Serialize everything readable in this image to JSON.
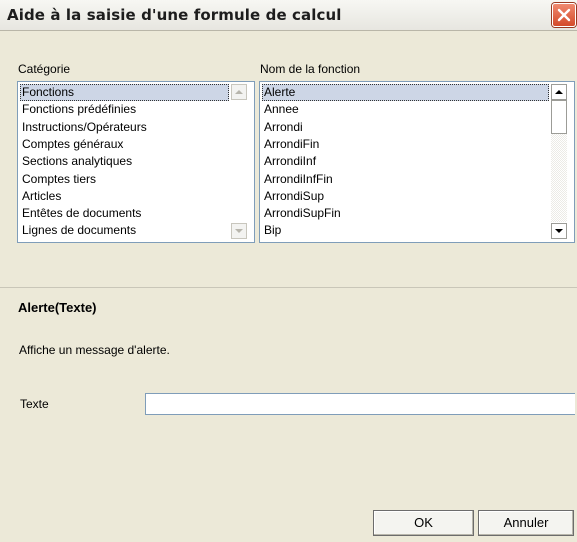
{
  "window": {
    "title": "Aide à la saisie d'une formule de calcul",
    "close_icon": "close-icon"
  },
  "category": {
    "label": "Catégorie",
    "items": [
      "Fonctions",
      "Fonctions prédéfinies",
      "Instructions/Opérateurs",
      "Comptes généraux",
      "Sections analytiques",
      "Comptes tiers",
      "Articles",
      "Entêtes de documents",
      "Lignes de documents"
    ],
    "selected": "Fonctions"
  },
  "function_list": {
    "label": "Nom de la fonction",
    "items": [
      "Alerte",
      "Annee",
      "Arrondi",
      "ArrondiFin",
      "ArrondiInf",
      "ArrondiInfFin",
      "ArrondiSup",
      "ArrondiSupFin",
      "Bip"
    ],
    "selected": "Alerte"
  },
  "detail": {
    "signature": "Alerte(Texte)",
    "description": "Affiche un message d'alerte.",
    "param_label": "Texte",
    "param_value": ""
  },
  "buttons": {
    "ok": "OK",
    "cancel": "Annuler"
  }
}
